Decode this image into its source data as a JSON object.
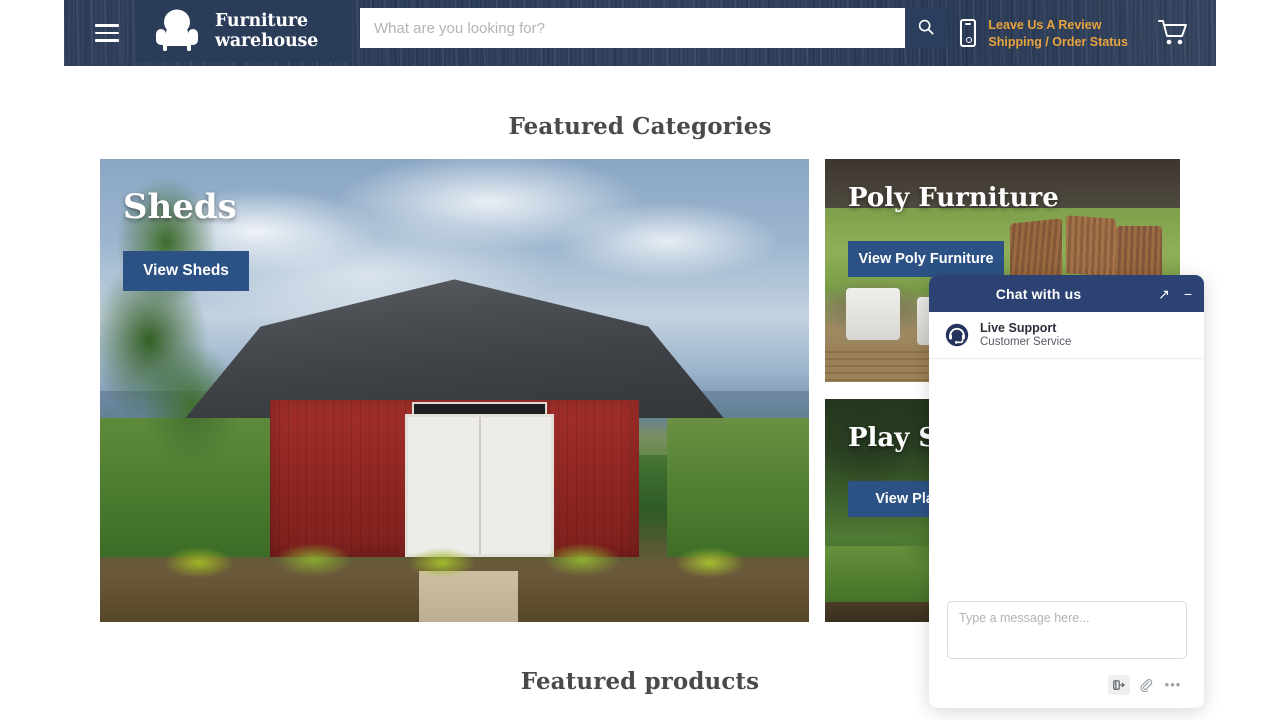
{
  "header": {
    "menu_icon": "hamburger-menu-icon",
    "logo": {
      "icon": "armchair-icon",
      "line1": "Furniture",
      "line2": "warehouse"
    },
    "search": {
      "placeholder": "What are you looking for?",
      "value": "",
      "button_icon": "search-icon"
    },
    "phone_icon": "mobile-phone-icon",
    "links": [
      {
        "label": "Leave Us A Review"
      },
      {
        "label": "Shipping / Order Status"
      }
    ],
    "cart_icon": "shopping-cart-icon",
    "link_color": "#e8a33d",
    "background_color": "#2d3e5b"
  },
  "sections": {
    "featured_categories_title": "Featured Categories",
    "featured_products_title": "Featured products"
  },
  "categories": [
    {
      "id": "sheds",
      "title": "Sheds",
      "button_label": "View Sheds"
    },
    {
      "id": "poly-furniture",
      "title": "Poly Furniture",
      "button_label": "View Poly Furniture"
    },
    {
      "id": "play-sets",
      "title": "Play Sets",
      "button_label": "View Play Sets"
    }
  ],
  "chat": {
    "title": "Chat with us",
    "expand_icon": "open-in-new-icon",
    "minimize_icon": "minimize-icon",
    "agent": {
      "avatar_icon": "headset-support-icon",
      "name": "Live Support",
      "role": "Customer Service"
    },
    "composer": {
      "placeholder": "Type a message here...",
      "value": "",
      "tools": [
        {
          "icon": "canned-response-icon",
          "active": true
        },
        {
          "icon": "paperclip-attachment-icon",
          "active": false
        },
        {
          "icon": "more-options-icon",
          "active": false
        }
      ]
    },
    "header_color": "#2c4273"
  },
  "theme": {
    "button_blue": "#2c5285",
    "heading_gray": "#4a4a4a"
  }
}
